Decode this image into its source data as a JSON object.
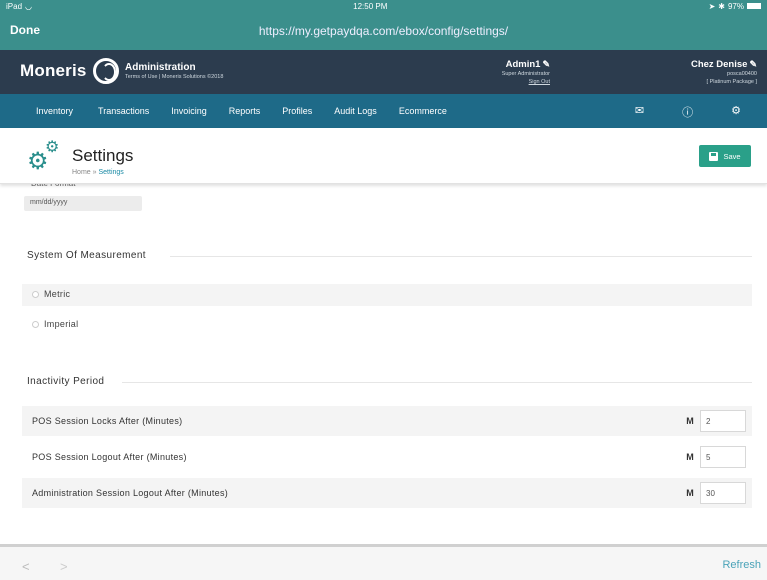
{
  "status_bar": {
    "device": "iPad",
    "wifi": "wifi-icon",
    "time": "12:50 PM",
    "battery": "97%"
  },
  "browser": {
    "done_label": "Done",
    "url": "https://my.getpaydqa.com/ebox/config/settings/",
    "refresh_label": "Refresh"
  },
  "header": {
    "brand": "Moneris",
    "section_title": "Administration",
    "section_sub": "Terms of Use | Moneris Solutions ©2018",
    "user_name": "Admin1",
    "user_role": "Super Administrator",
    "sign_out": "Sign Out",
    "store_name": "Chez Denise",
    "store_id": "posca00400",
    "store_package": "[ Platinum Package ]"
  },
  "nav": {
    "items": [
      "Inventory",
      "Transactions",
      "Invoicing",
      "Reports",
      "Profiles",
      "Audit Logs",
      "Ecommerce"
    ]
  },
  "page": {
    "title": "Settings",
    "breadcrumb_home": "Home",
    "breadcrumb_sep": "»",
    "breadcrumb_current": "Settings",
    "save_label": "Save"
  },
  "date_format": {
    "label": "Date Format",
    "value": "mm/dd/yyyy"
  },
  "measurement": {
    "title": "System Of Measurement",
    "options": [
      "Metric",
      "Imperial"
    ]
  },
  "inactivity": {
    "title": "Inactivity Period",
    "rows": [
      {
        "label": "POS Session Locks After (Minutes)",
        "unit": "M",
        "value": "2"
      },
      {
        "label": "POS Session Logout After (Minutes)",
        "unit": "M",
        "value": "5"
      },
      {
        "label": "Administration Session Logout After (Minutes)",
        "unit": "M",
        "value": "30"
      }
    ]
  },
  "colors": {
    "teal_bar": "#3b8f8c",
    "header_dark": "#2c3c4e",
    "nav_blue": "#1e6a88",
    "save_green": "#2aa089"
  }
}
